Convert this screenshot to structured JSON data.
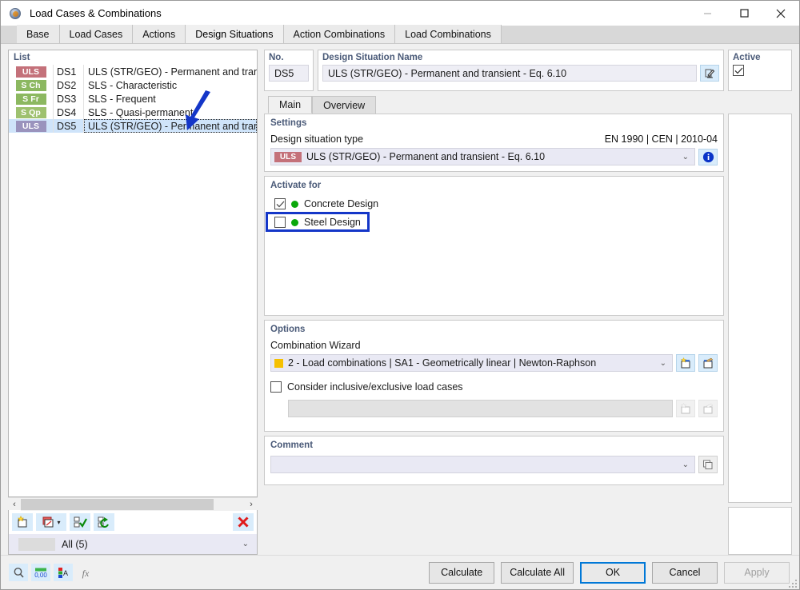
{
  "window": {
    "title": "Load Cases & Combinations",
    "icon": "app-icon",
    "minimize": "–",
    "maximize": "□",
    "close": "×"
  },
  "tabs": [
    {
      "label": "Base",
      "active": false
    },
    {
      "label": "Load Cases",
      "active": false
    },
    {
      "label": "Actions",
      "active": false
    },
    {
      "label": "Design Situations",
      "active": true
    },
    {
      "label": "Action Combinations",
      "active": false
    },
    {
      "label": "Load Combinations",
      "active": false
    }
  ],
  "list": {
    "title": "List",
    "rows": [
      {
        "badge": "ULS",
        "badge_color": "#c4717a",
        "no": "DS1",
        "name": "ULS (STR/GEO) - Permanent and transient - E",
        "selected": false
      },
      {
        "badge": "S Ch",
        "badge_color": "#8cb860",
        "no": "DS2",
        "name": "SLS - Characteristic",
        "selected": false
      },
      {
        "badge": "S Fr",
        "badge_color": "#8cb860",
        "no": "DS3",
        "name": "SLS - Frequent",
        "selected": false
      },
      {
        "badge": "S Qp",
        "badge_color": "#9ec16f",
        "no": "DS4",
        "name": "SLS - Quasi-permanent",
        "selected": false
      },
      {
        "badge": "ULS",
        "badge_color": "#9a93bd",
        "no": "DS5",
        "name": "ULS (STR/GEO) - Permanent and transient - E",
        "selected": true
      }
    ],
    "scroll_left": "‹",
    "scroll_right": "›",
    "toolbar": [
      {
        "name": "new-design-situation-button",
        "icon": "new-item-icon"
      },
      {
        "name": "copy-design-situation-button",
        "icon": "copy-item-icon",
        "has_dropdown": true
      },
      {
        "name": "select-all-button",
        "icon": "check-all-icon"
      },
      {
        "name": "invert-selection-button",
        "icon": "invert-selection-icon"
      },
      {
        "name": "delete-button",
        "icon": "delete-icon"
      }
    ],
    "filter_label": "All (5)"
  },
  "detail": {
    "no_label": "No.",
    "no_value": "DS5",
    "name_label": "Design Situation Name",
    "name_value": "ULS (STR/GEO) - Permanent and transient - Eq. 6.10",
    "edit_icon": "edit-pencil-icon",
    "active_label": "Active",
    "active_checked": true,
    "subtabs": [
      {
        "label": "Main",
        "active": true
      },
      {
        "label": "Overview",
        "active": false
      }
    ],
    "settings": {
      "title": "Settings",
      "type_label": "Design situation type",
      "standard": "EN 1990 | CEN | 2010-04",
      "type_badge": "ULS",
      "type_badge_color": "#c4717a",
      "type_value": "ULS (STR/GEO) - Permanent and transient - Eq. 6.10",
      "info_icon": "info-icon"
    },
    "activate": {
      "title": "Activate for",
      "items": [
        {
          "label": "Concrete Design",
          "checked": true,
          "dot_color": "#0aa80a",
          "highlighted": false
        },
        {
          "label": "Steel Design",
          "checked": false,
          "dot_color": "#0aa80a",
          "highlighted": true
        }
      ]
    },
    "options": {
      "title": "Options",
      "wizard_label": "Combination Wizard",
      "wizard_swatch": "#f5c000",
      "wizard_value": "2 - Load combinations | SA1 - Geometrically linear | Newton-Raphson",
      "new_wizard_icon": "new-wizard-icon",
      "edit_wizard_icon": "edit-wizard-icon",
      "inclusive_label": "Consider inclusive/exclusive load cases",
      "inclusive_checked": false,
      "inclusive_value": "",
      "new_inclusive_icon": "new-item-icon",
      "edit_inclusive_icon": "edit-item-icon"
    },
    "comment": {
      "title": "Comment",
      "value": "",
      "copy_icon": "copy-comment-icon"
    }
  },
  "footer": {
    "icons": [
      {
        "name": "search-object-icon"
      },
      {
        "name": "decimal-places-icon"
      },
      {
        "name": "colors-icon"
      },
      {
        "name": "formula-icon"
      }
    ],
    "buttons": [
      {
        "label": "Calculate",
        "state": "normal"
      },
      {
        "label": "Calculate All",
        "state": "normal"
      },
      {
        "label": "OK",
        "state": "primary"
      },
      {
        "label": "Cancel",
        "state": "normal"
      },
      {
        "label": "Apply",
        "state": "disabled"
      }
    ]
  },
  "annotations": {
    "arrow_color": "#1436c8",
    "box_color": "#1436c8"
  }
}
